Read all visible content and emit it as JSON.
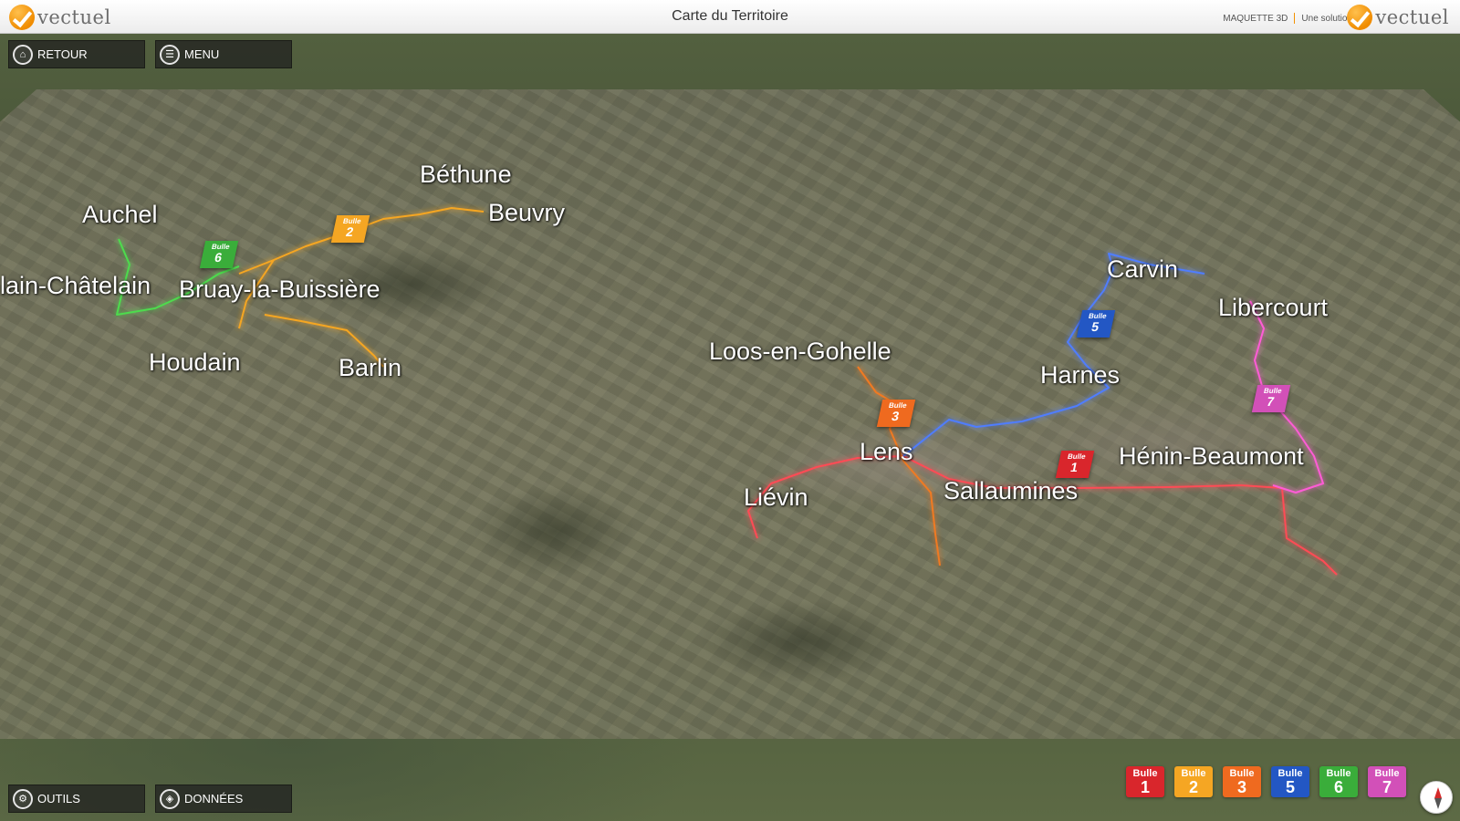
{
  "header": {
    "title": "Carte du Territoire",
    "logo_text": "vectuel",
    "product": "MAQUETTE 3D",
    "tagline": "Une solution"
  },
  "buttons": {
    "back": "RETOUR",
    "menu": "MENU",
    "tools": "OUTILS",
    "data": "DONNÉES"
  },
  "cities": {
    "bethune": "Béthune",
    "beuvry": "Beuvry",
    "auchel": "Auchel",
    "camblain": "lain-Châtelain",
    "bruay": "Bruay-la-Buissière",
    "houdain": "Houdain",
    "barlin": "Barlin",
    "loos": "Loos-en-Gohelle",
    "lens": "Lens",
    "lievin": "Liévin",
    "sallaumines": "Sallaumines",
    "harnes": "Harnes",
    "carvin": "Carvin",
    "libercourt": "Libercourt",
    "henin": "Hénin-Beaumont"
  },
  "markers": {
    "b1": {
      "word": "Bulle",
      "num": "1"
    },
    "b2": {
      "word": "Bulle",
      "num": "2"
    },
    "b3": {
      "word": "Bulle",
      "num": "3"
    },
    "b5": {
      "word": "Bulle",
      "num": "5"
    },
    "b6": {
      "word": "Bulle",
      "num": "6"
    },
    "b7": {
      "word": "Bulle",
      "num": "7"
    }
  },
  "legend": [
    {
      "word": "Bulle",
      "num": "1",
      "color": "#d9262c"
    },
    {
      "word": "Bulle",
      "num": "2",
      "color": "#f5a623"
    },
    {
      "word": "Bulle",
      "num": "3",
      "color": "#ef6a1f"
    },
    {
      "word": "Bulle",
      "num": "5",
      "color": "#2357c4"
    },
    {
      "word": "Bulle",
      "num": "6",
      "color": "#3aad3a"
    },
    {
      "word": "Bulle",
      "num": "7",
      "color": "#d250b8"
    }
  ],
  "colors": {
    "route1": "#ff4b55",
    "route2": "#f5a623",
    "route3": "#f07a22",
    "route5": "#4f7dff",
    "route6": "#4ddc4d",
    "route7": "#ff5bd6",
    "brand": "#f39200"
  }
}
